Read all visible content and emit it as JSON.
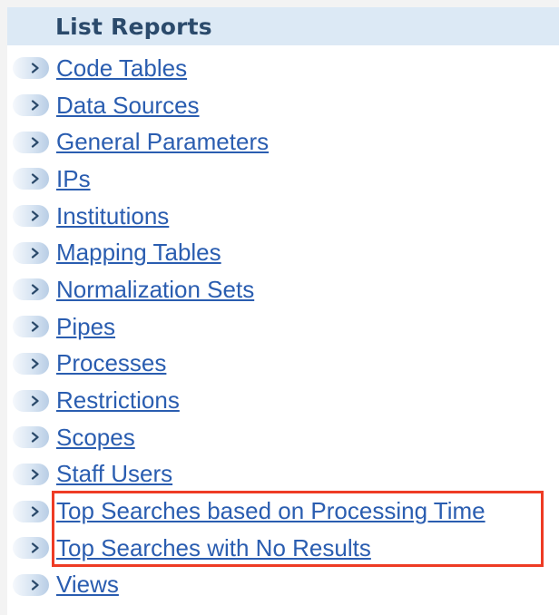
{
  "header": {
    "title": "List Reports"
  },
  "items": [
    {
      "label": "Code Tables"
    },
    {
      "label": "Data Sources"
    },
    {
      "label": "General Parameters"
    },
    {
      "label": "IPs"
    },
    {
      "label": "Institutions"
    },
    {
      "label": "Mapping Tables"
    },
    {
      "label": "Normalization Sets"
    },
    {
      "label": "Pipes"
    },
    {
      "label": "Processes"
    },
    {
      "label": "Restrictions"
    },
    {
      "label": "Scopes"
    },
    {
      "label": "Staff Users"
    },
    {
      "label": "Top Searches based on Processing Time"
    },
    {
      "label": "Top Searches with No Results"
    },
    {
      "label": "Views"
    }
  ],
  "highlight": {
    "color": "#ee3b24",
    "items": [
      "Top Searches based on Processing Time",
      "Top Searches with No Results"
    ]
  },
  "colors": {
    "header_bg": "#dce9f5",
    "header_text": "#2b4a6b",
    "link": "#2a5db0"
  },
  "icons": {
    "bullet": "chevron-right-icon"
  }
}
